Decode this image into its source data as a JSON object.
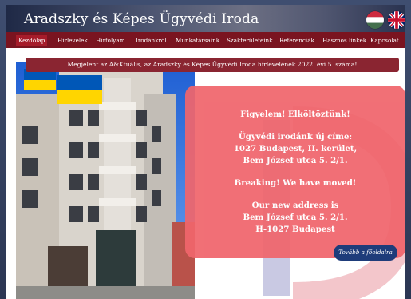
{
  "header": {
    "title": "Aradszky és Képes Ügyvédi Iroda"
  },
  "languages": [
    {
      "name": "hungarian-flag-icon"
    },
    {
      "name": "british-flag-icon"
    }
  ],
  "nav": [
    {
      "label": "Kezdőlap",
      "active": true
    },
    {
      "label": "Hírlevelek"
    },
    {
      "label": "Hírfolyam"
    },
    {
      "label": "Irodánkról"
    },
    {
      "label": "Munkatársaink"
    },
    {
      "label": "Szakterületeink"
    },
    {
      "label": "Referenciák"
    },
    {
      "label": "Hasznos linkek"
    },
    {
      "label": "Kapcsolat"
    }
  ],
  "announcement": "Megjelent az A&Ktuális, az Aradszky és Képes Ügyvédi Iroda hírlevelének 2022. évi 5. száma!",
  "notice": {
    "title_hu": "Figyelem! Elköltöztünk!",
    "line1_hu": "Ügyvédi irodánk új címe:",
    "line2_hu": "1027 Budapest, II. kerület,",
    "line3_hu": "Bem József utca 5. 2/1.",
    "title_en": "Breaking! We have moved!",
    "line1_en": "Our new address is",
    "line2_en": "Bem József utca 5. 2/1.",
    "line3_en": "H-1027 Budapest"
  },
  "more_button": "Tovább a főoldalra",
  "colors": {
    "nav": "#7a1420",
    "notice": "#f0656c",
    "button": "#1e3c7a"
  }
}
